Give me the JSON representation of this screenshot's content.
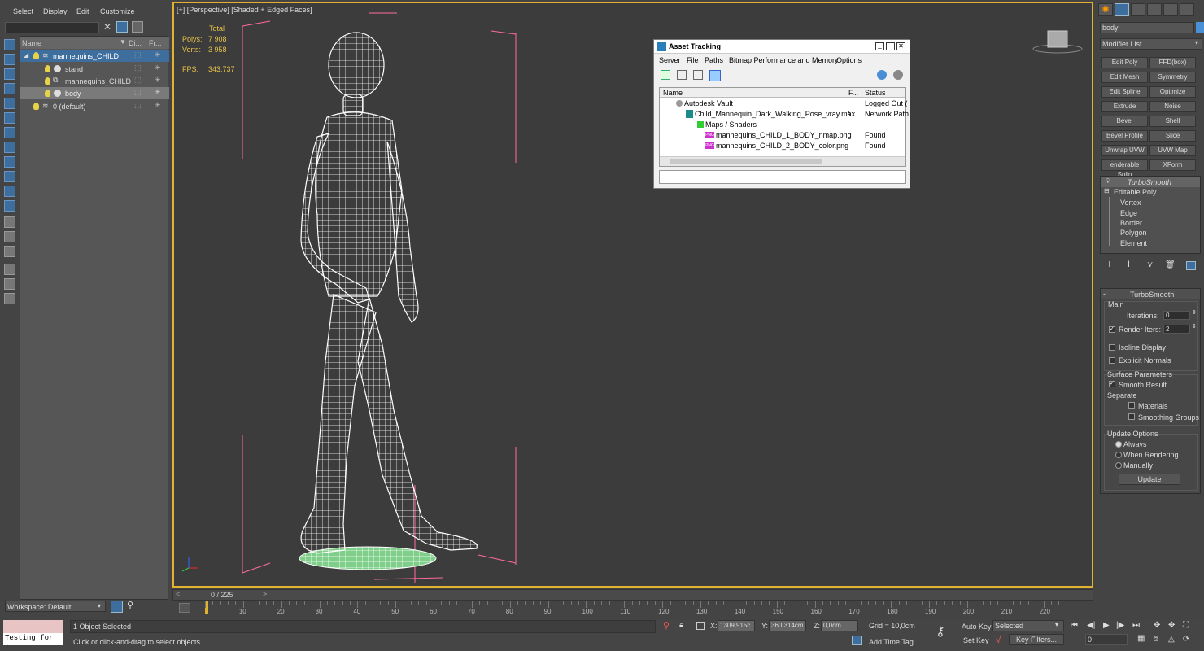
{
  "menu": {
    "select": "Select",
    "display": "Display",
    "edit": "Edit",
    "customize": "Customize"
  },
  "explorer": {
    "col_name": "Name",
    "col_display": "Di...",
    "col_freeze": "Fr...",
    "items": [
      {
        "label": "mannequins_CHILD"
      },
      {
        "label": "stand"
      },
      {
        "label": "mannequins_CHILD"
      },
      {
        "label": "body"
      },
      {
        "label": "0 (default)"
      }
    ],
    "workspace": "Workspace: Default"
  },
  "viewport": {
    "label": "[+] [Perspective] [Shaded + Edged Faces]",
    "stats_total": "Total",
    "polys_label": "Polys:",
    "polys_value": "7 908",
    "verts_label": "Verts:",
    "verts_value": "3 958",
    "fps_label": "FPS:",
    "fps_value": "343.737"
  },
  "timeline": {
    "frame": "0 / 225",
    "frame_fraction": 0,
    "ticks": [
      "10",
      "20",
      "30",
      "40",
      "50",
      "60",
      "70",
      "80",
      "90",
      "100",
      "110",
      "120",
      "130",
      "140",
      "150",
      "160",
      "170",
      "180",
      "190",
      "200",
      "210",
      "220"
    ]
  },
  "status": {
    "maxscript": "Testing for ;",
    "selected": "1 Object Selected",
    "prompt": "Click or click-and-drag to select objects",
    "x_label": "X:",
    "x_value": "1309,915c",
    "y_label": "Y:",
    "y_value": "360,314cm",
    "z_label": "Z:",
    "z_value": "0,0cm",
    "grid": "Grid = 10,0cm",
    "add_time_tag": "Add Time Tag",
    "auto_key": "Auto Key",
    "set_key": "Set Key",
    "selected_dropdown": "Selected",
    "key_filters": "Key Filters...",
    "frame_field": "0"
  },
  "command_panel": {
    "object_name": "body",
    "modifier_list": "Modifier List",
    "buttons": [
      "Edit Poly",
      "FFD(box)",
      "Edit Mesh",
      "Symmetry",
      "Edit Spline",
      "Optimize",
      "Extrude",
      "Noise",
      "Bevel",
      "Shell",
      "Bevel Profile",
      "Slice",
      "Unwrap UVW",
      "UVW Map",
      "enderable Splin",
      "XForm"
    ],
    "stack": {
      "turbosmooth": "TurboSmooth",
      "editable_poly": "Editable Poly",
      "subs": [
        "Vertex",
        "Edge",
        "Border",
        "Polygon",
        "Element"
      ]
    },
    "turbosmooth": {
      "title": "TurboSmooth",
      "main": "Main",
      "iterations_label": "Iterations:",
      "iterations": "0",
      "render_iters_label": "Render Iters:",
      "render_iters": "2",
      "isoline": "Isoline Display",
      "explicit_normals": "Explicit Normals",
      "surface_params": "Surface Parameters",
      "smooth_result": "Smooth Result",
      "separate": "Separate",
      "materials": "Materials",
      "smoothing_groups": "Smoothing Groups",
      "update_options": "Update Options",
      "always": "Always",
      "when_rendering": "When Rendering",
      "manually": "Manually",
      "update": "Update"
    }
  },
  "asset_tracking": {
    "title": "Asset Tracking",
    "menu": [
      "Server",
      "File",
      "Paths",
      "Bitmap Performance and Memory",
      "Options"
    ],
    "col_name": "Name",
    "col_f": "F...",
    "col_status": "Status",
    "rows": [
      {
        "name": "Autodesk Vault",
        "f": "",
        "status": "Logged Out ("
      },
      {
        "name": "Child_Mannequin_Dark_Walking_Pose_vray.max",
        "f": "\\...",
        "status": "Network Path"
      },
      {
        "name": "Maps / Shaders",
        "f": "",
        "status": ""
      },
      {
        "name": "mannequins_CHILD_1_BODY_nmap.png",
        "f": "",
        "status": "Found"
      },
      {
        "name": "mannequins_CHILD_2_BODY_color.png",
        "f": "",
        "status": "Found"
      }
    ],
    "png_badge": "PNG"
  },
  "colors": {
    "accent": "#3d6e9e",
    "viewport_border": "#e3b130",
    "wire": "#ffffff",
    "bbox": "#ff6b9a",
    "stats": "#e8c34a"
  }
}
